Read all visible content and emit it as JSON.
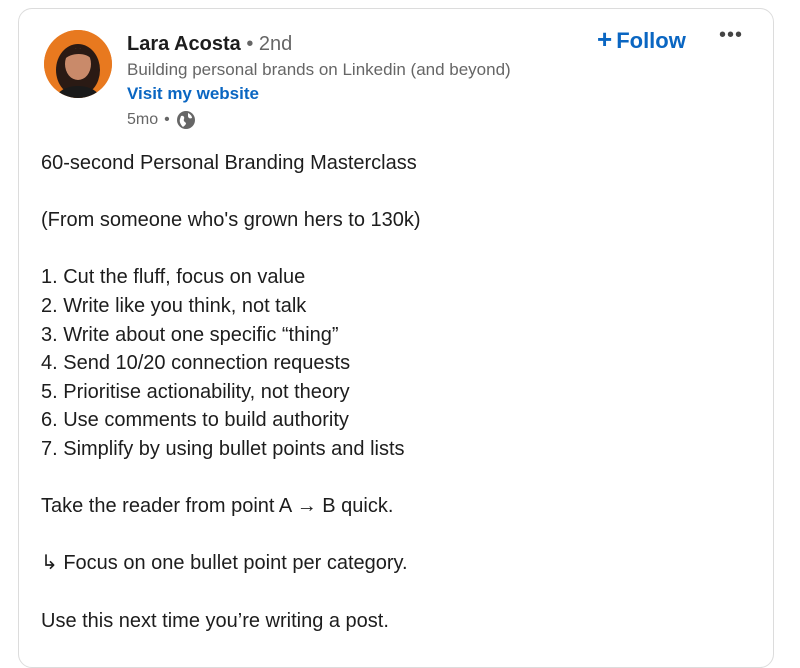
{
  "post": {
    "author": {
      "name": "Lara Acosta",
      "separator": "•",
      "degree": "2nd",
      "headline": "Building personal brands on Linkedin (and beyond)",
      "website_link": "Visit my website",
      "time": "5mo",
      "time_separator": "•",
      "visibility_icon": "globe-icon"
    },
    "actions": {
      "follow_plus": "+",
      "follow_label": "Follow",
      "more": "•••"
    },
    "content": {
      "title": "60-second Personal Branding Masterclass",
      "subtitle": "(From someone who's grown hers to 130k)",
      "list": [
        "1. Cut the fluff, focus on value",
        "2. Write like you think, not talk",
        "3. Write about one specific “thing”",
        "4. Send 10/20 connection requests",
        "5. Prioritise actionability, not theory",
        "6. Use comments to build authority",
        "7. Simplify by using bullet points and lists"
      ],
      "takeaway": "Take the reader from point A → B quick.",
      "tip": "↳ Focus on one bullet point per category.",
      "closing": "Use this next time you’re writing a post."
    },
    "colors": {
      "link_blue": "#0a66c2",
      "text": "#1d1d1d",
      "muted": "#666666"
    }
  }
}
